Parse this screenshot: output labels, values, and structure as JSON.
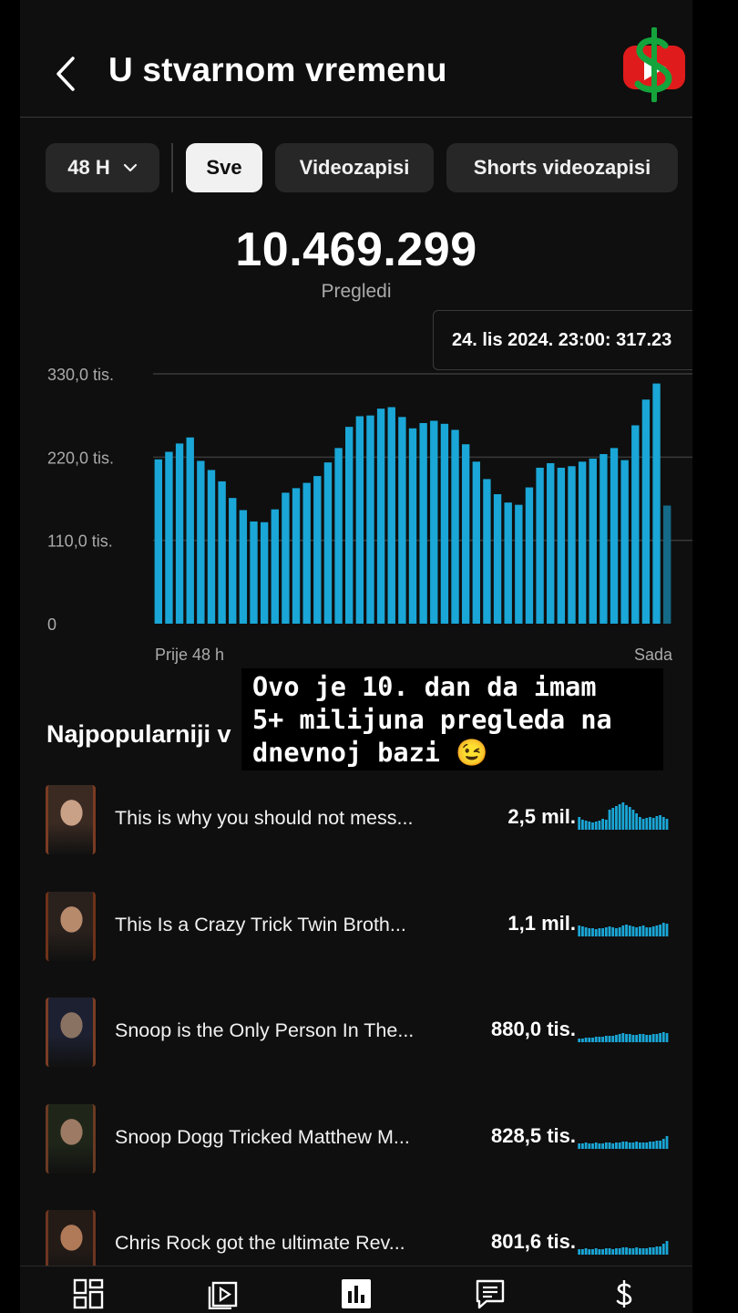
{
  "header": {
    "title": "U stvarnom vremenu",
    "back_icon": "chevron-left-icon",
    "logo_icon": "youtube-dollar-logo"
  },
  "filters": {
    "period": "48 H",
    "chips": [
      "Sve",
      "Videozapisi",
      "Shorts videozapisi"
    ],
    "active_chip": "Sve"
  },
  "summary": {
    "total": "10.469.299",
    "label": "Pregledi"
  },
  "tooltip": "24. lis 2024. 23:00: 317.23",
  "chart_data": {
    "type": "bar",
    "y_tick_labels": [
      "330,0 tis.",
      "220,0 tis.",
      "110,0 tis.",
      "0"
    ],
    "y_ticks": [
      330000,
      220000,
      110000,
      0
    ],
    "ylim": [
      0,
      330000
    ],
    "x_start_label": "Prije 48 h",
    "x_end_label": "Sada",
    "grid": true,
    "colors": {
      "bar": "#1aa6d6",
      "current_bar": "#156a88",
      "grid": "#3a3a3a"
    },
    "values": [
      217000,
      227000,
      238000,
      246000,
      215000,
      203000,
      188000,
      166000,
      150000,
      135000,
      134000,
      151000,
      173000,
      179000,
      186000,
      195000,
      213000,
      232000,
      260000,
      274000,
      275000,
      284000,
      286000,
      273000,
      258000,
      265000,
      268000,
      264000,
      256000,
      237000,
      214000,
      191000,
      171000,
      160000,
      157000,
      180000,
      206000,
      212000,
      206000,
      208000,
      214000,
      218000,
      224000,
      232000,
      216000,
      262000,
      296000,
      317230,
      156000
    ]
  },
  "annotation": "Ovo je 10. dan da imam\n5+ milijuna pregleda na\ndnevnoj bazi 😉",
  "top_section_title": "Najpopularniji v",
  "videos": [
    {
      "title": "This is why you should not mess...",
      "views": "2,5 mil.",
      "spark": [
        14,
        11,
        10,
        9,
        8,
        9,
        10,
        12,
        11,
        22,
        24,
        26,
        28,
        30,
        27,
        25,
        22,
        18,
        14,
        12,
        13,
        14,
        13,
        15,
        16,
        14,
        12
      ]
    },
    {
      "title": "This Is a Crazy Trick Twin Broth...",
      "views": "1,1 mil.",
      "spark": [
        12,
        11,
        10,
        9,
        9,
        8,
        9,
        9,
        10,
        11,
        10,
        9,
        10,
        12,
        13,
        12,
        11,
        10,
        11,
        12,
        10,
        10,
        11,
        12,
        13,
        15,
        14
      ]
    },
    {
      "title": "Snoop is the Only Person In The...",
      "views": "880,0 tis.",
      "spark": [
        4,
        4,
        5,
        5,
        5,
        6,
        6,
        6,
        7,
        7,
        7,
        8,
        9,
        10,
        9,
        9,
        8,
        8,
        9,
        9,
        8,
        8,
        9,
        9,
        10,
        11,
        10
      ]
    },
    {
      "title": "Snoop Dogg Tricked Matthew M...",
      "views": "828,5 tis.",
      "spark": [
        6,
        6,
        7,
        6,
        6,
        7,
        6,
        6,
        7,
        7,
        6,
        7,
        7,
        8,
        8,
        7,
        7,
        8,
        7,
        7,
        7,
        8,
        8,
        9,
        9,
        11,
        14
      ]
    },
    {
      "title": "Chris Rock got the ultimate Rev...",
      "views": "801,6 tis.",
      "spark": [
        6,
        6,
        7,
        6,
        6,
        7,
        6,
        6,
        7,
        7,
        6,
        7,
        7,
        8,
        8,
        7,
        7,
        8,
        7,
        7,
        7,
        8,
        8,
        9,
        9,
        12,
        15
      ]
    }
  ],
  "nav": [
    "dashboard-grid-icon",
    "content-video-icon",
    "analytics-bars-icon",
    "comments-icon",
    "earn-dollar-icon"
  ],
  "colors": {
    "background": "#0f0f0f",
    "accent": "#1aa6d6",
    "chip_bg": "#272727",
    "chip_active_bg": "#f1f1f1",
    "text_secondary": "#aaaaaa"
  }
}
